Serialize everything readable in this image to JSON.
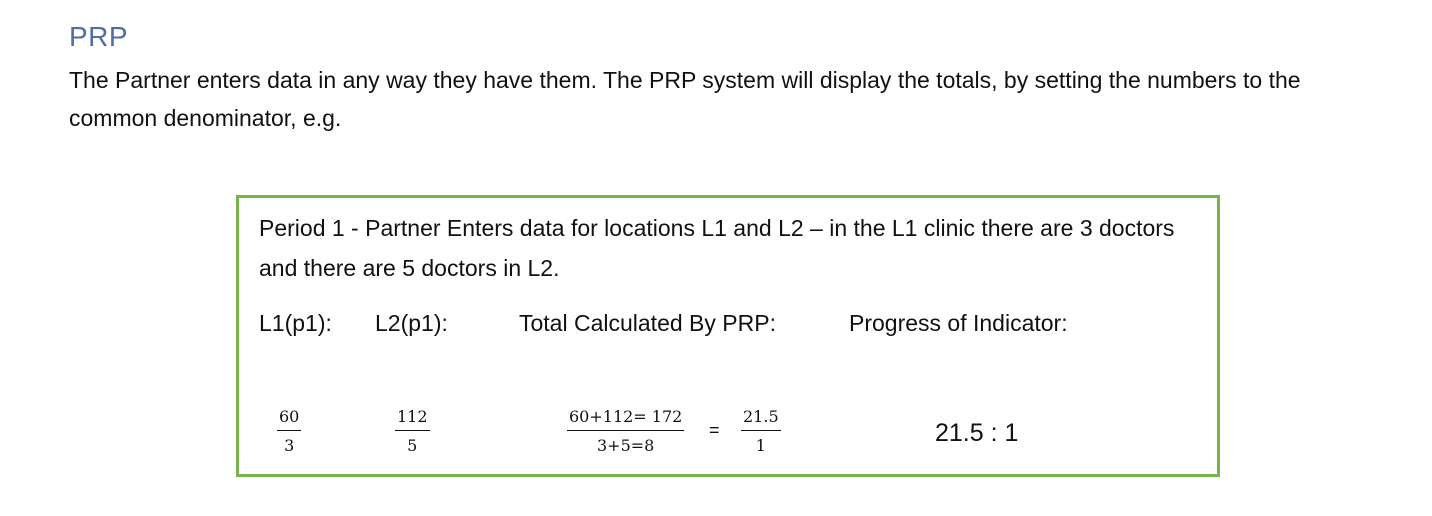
{
  "heading": "PRP",
  "intro": "The Partner enters data in any way they have them. The PRP system will display the totals, by setting the numbers to the common denominator, e.g.",
  "example": {
    "description": "Period 1 - Partner Enters data for locations L1 and L2 – in the L1 clinic there are 3 doctors and there are 5 doctors in L2.",
    "columns": {
      "l1": "L1(p1):",
      "l2": "L2(p1):",
      "total": "Total Calculated By PRP:",
      "progress": "Progress of Indicator:"
    },
    "l1_fraction": {
      "numerator": "60",
      "denominator": "3"
    },
    "l2_fraction": {
      "numerator": "112",
      "denominator": "5"
    },
    "total_fraction": {
      "numerator": "60+112= 172",
      "denominator": "3+5=8"
    },
    "equals": "=",
    "result_fraction": {
      "numerator": "21.5",
      "denominator": "1"
    },
    "progress_value": "21.5 : 1",
    "border_color": "#79b34d"
  },
  "heading_color": "#4e6fa3"
}
